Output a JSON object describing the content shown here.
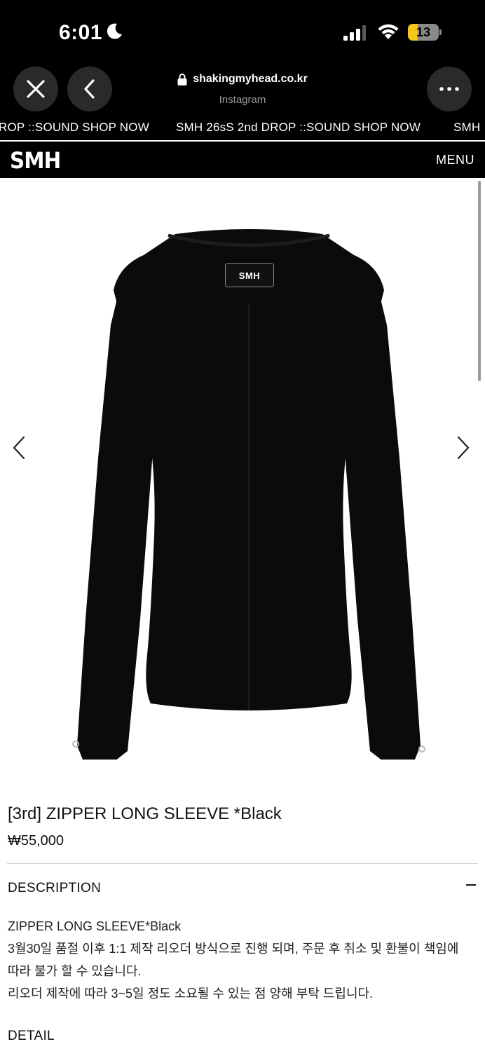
{
  "status_bar": {
    "time": "6:01",
    "battery_level": "13",
    "icons": [
      "moon-icon",
      "signal-icon",
      "wifi-icon",
      "battery-icon"
    ]
  },
  "browser": {
    "url": "shakingmyhead.co.kr",
    "source": "Instagram",
    "icons": [
      "close-icon",
      "back-icon",
      "lock-icon",
      "more-icon"
    ]
  },
  "marquee": {
    "items": [
      "ROP ::SOUND SHOP NOW",
      "SMH 26sS 2nd DROP ::SOUND SHOP NOW",
      "SMH"
    ]
  },
  "header": {
    "logo": "SMH",
    "menu_label": "MENU"
  },
  "gallery": {
    "icons": [
      "chevron-left-icon",
      "chevron-right-icon"
    ],
    "label_brand": "SMH"
  },
  "product": {
    "title": "[3rd] ZIPPER LONG SLEEVE *Black",
    "price": "₩55,000"
  },
  "description": {
    "heading": "DESCRIPTION",
    "lines": [
      "ZIPPER LONG SLEEVE*Black",
      "3월30일 품절 이후 1:1 제작 리오더 방식으로 진행 되며, 주문 후 취소 및 환불이 책임에",
      "따라 불가 할 수 있습니다.",
      "리오더 제작에 따라 3~5일 정도 소요될 수 있는 점 양해 부탁 드립니다."
    ]
  },
  "detail": {
    "heading": "DETAIL"
  },
  "colors": {
    "header_bg": "#000000",
    "battery_fill": "#f5c518"
  }
}
